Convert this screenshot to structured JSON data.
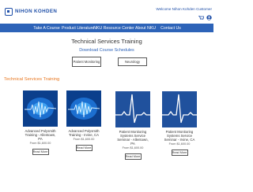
{
  "header": {
    "logo_text": "NIHON KOHDEN",
    "logo_sub": "",
    "welcome": "Welcome Nihon Kohden Customer"
  },
  "nav": {
    "items": [
      {
        "label": "Take A Course"
      },
      {
        "label": "Product Literature"
      },
      {
        "label": "NKU Resource Center"
      },
      {
        "label": "About NKU"
      },
      {
        "label": "Contact Us"
      }
    ]
  },
  "main": {
    "title": "Technical Services Training",
    "subtitle": "Download Course Schedules",
    "filters": [
      {
        "label": "Patient Monitoring"
      },
      {
        "label": "Neurology"
      }
    ],
    "section_title": "Technical Services Training",
    "cards": [
      {
        "title": "Advanced Polysmith Training - Allentown, PA",
        "price": "From $1,600.00",
        "button": "Read More",
        "image": "brainwave"
      },
      {
        "title": "Advanced Polysmith Training - Irvine, CA",
        "price": "From $1,600.00",
        "button": "Read More",
        "image": "brainwave"
      },
      {
        "title": "Patient Monitoring Systems Service Seminar - Allentown, PA",
        "price": "From $1,600.00",
        "button": "Read More",
        "image": "ecg"
      },
      {
        "title": "Patient Monitoring Systems Service Seminar - Irvine, CA",
        "price": "From $1,600.00",
        "button": "Read More",
        "image": "ecg"
      }
    ]
  },
  "colors": {
    "brand_blue": "#2d63b8",
    "accent_orange": "#e8761e"
  }
}
